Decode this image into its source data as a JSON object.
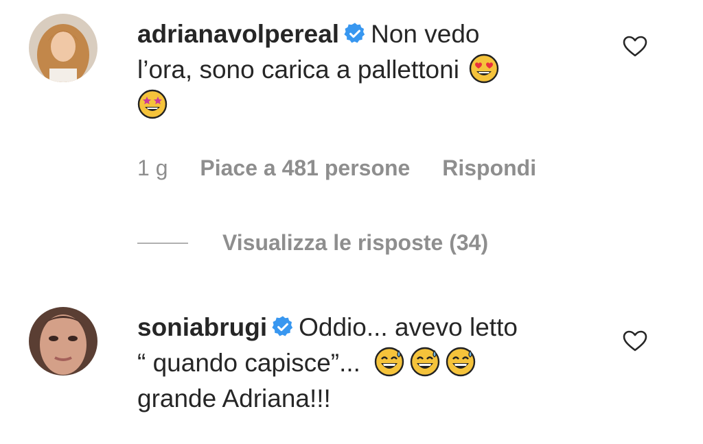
{
  "comments": [
    {
      "username": "adrianavolpereal",
      "verified": true,
      "text_line1": "Non vedo",
      "text_line2": "l’ora, sono carica a pallettoni",
      "emojis": [
        "heart-eyes",
        "star-struck"
      ],
      "time": "1 g",
      "likes": "Piace a 481 persone",
      "reply": "Rispondi",
      "view_replies": "Visualizza le risposte (34)"
    },
    {
      "username": "soniabrugi",
      "verified": true,
      "text_line1": "Oddio... avevo letto",
      "text_line2": "“ quando capisce”...",
      "text_line3": "grande Adriana!!!",
      "emojis": [
        "grinning-sweat",
        "grinning-sweat",
        "grinning-sweat"
      ]
    }
  ],
  "colors": {
    "text": "#262626",
    "secondary": "#8e8e8e",
    "verified_blue": "#3897f0",
    "emoji_yellow": "#f5c33b"
  }
}
